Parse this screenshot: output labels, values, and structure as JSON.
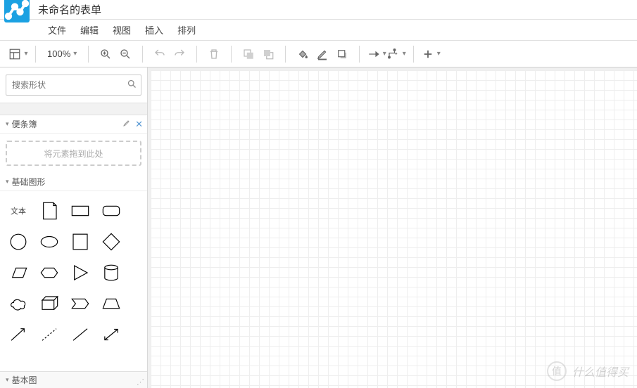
{
  "title": "未命名的表单",
  "menu": {
    "file": "文件",
    "edit": "编辑",
    "view": "视图",
    "insert": "插入",
    "arrange": "排列"
  },
  "toolbar": {
    "zoom": "100%"
  },
  "search": {
    "placeholder": "搜索形状"
  },
  "panels": {
    "scratchpad": {
      "title": "便条簿",
      "drop_hint": "将元素拖到此处"
    },
    "basic_shapes": {
      "title": "基础图形"
    },
    "basic": {
      "title": "基本图"
    }
  },
  "shapes": {
    "text_label": "文本"
  },
  "watermark": {
    "text": "什么值得买",
    "badge": "值"
  }
}
